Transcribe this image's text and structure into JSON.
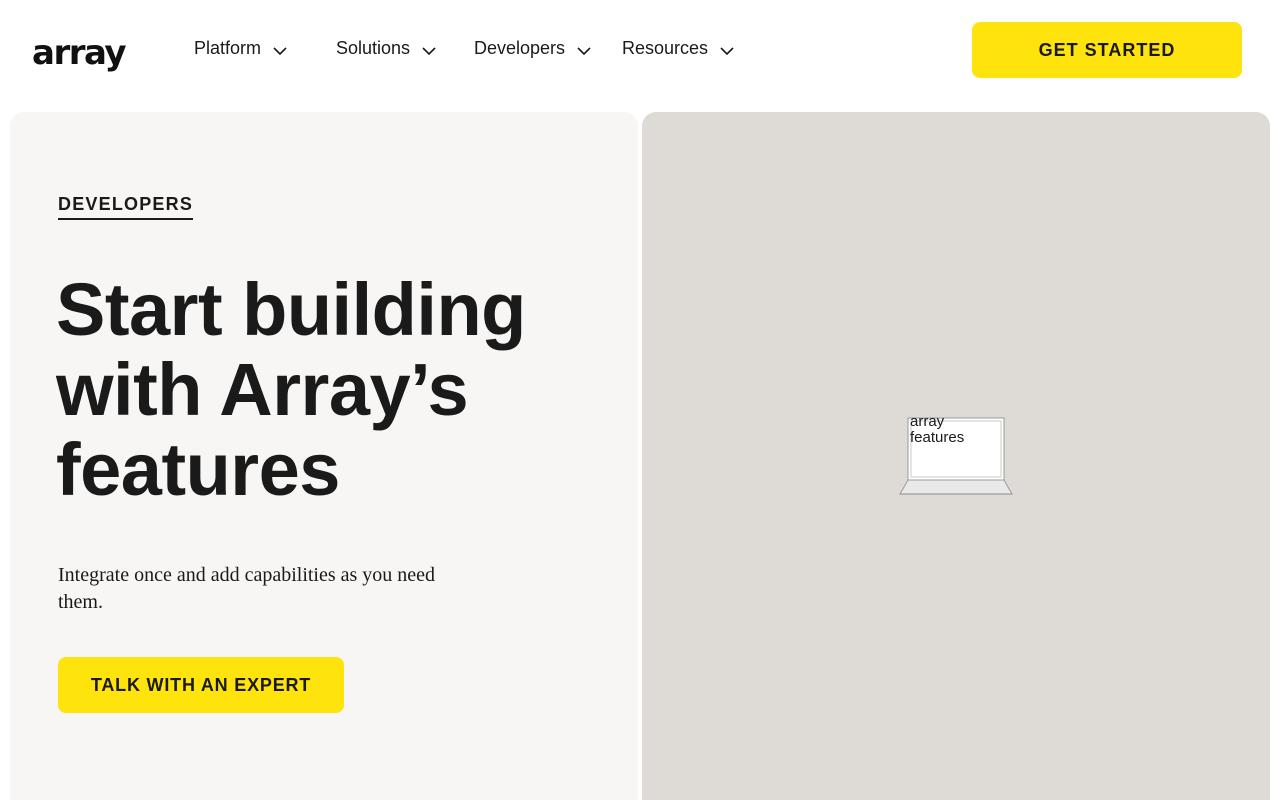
{
  "header": {
    "logo": "array",
    "nav": [
      {
        "label": "Platform"
      },
      {
        "label": "Solutions"
      },
      {
        "label": "Developers"
      },
      {
        "label": "Resources"
      }
    ],
    "cta_label": "GET STARTED"
  },
  "hero": {
    "eyebrow": "DEVELOPERS",
    "headline": "Start building with Array’s features",
    "subcopy": "Integrate once and add capabilities as you need them.",
    "cta_label": "TALK WITH AN EXPERT"
  },
  "media": {
    "image_alt": "array features"
  },
  "colors": {
    "accent": "#ffe30d",
    "left_panel_bg": "#f7f6f4",
    "right_panel_bg": "#dedbd6",
    "text": "#1a1a1a"
  }
}
